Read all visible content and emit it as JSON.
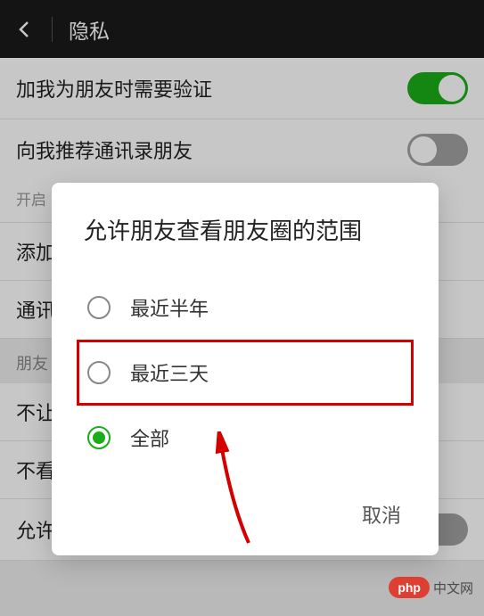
{
  "header": {
    "title": "隐私"
  },
  "rows": {
    "verify": "加我为朋友时需要验证",
    "recommend": "向我推荐通讯录朋友",
    "recommend_sub": "开启",
    "add_method": "添加",
    "blacklist": "通讯",
    "dont_let_see": "不让",
    "dont_see": "不看",
    "stranger_photos": "允许陌生人查看十张照片"
  },
  "section": {
    "moments": "朋友"
  },
  "dialog": {
    "title": "允许朋友查看朋友圈的范围",
    "options": [
      "最近半年",
      "最近三天",
      "全部"
    ],
    "cancel": "取消"
  },
  "badge": {
    "pill": "php",
    "text": "中文网"
  }
}
